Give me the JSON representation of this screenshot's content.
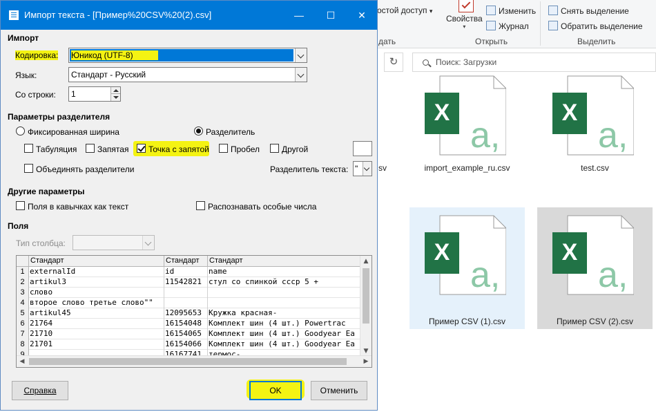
{
  "explorer": {
    "ribbon": {
      "items": {
        "access": "остой доступ",
        "access_arrow": "▾",
        "properties": "Свойства",
        "edit": "Изменить",
        "journal": "Журнал",
        "deselect": "Снять выделение",
        "invert": "Обратить выделение"
      },
      "groups": {
        "partial": "дать",
        "open": "Открыть",
        "select": "Выделить"
      }
    },
    "search_placeholder": "Поиск: Загрузки",
    "refresh_icon": "↻",
    "partial_label": "sv",
    "files": [
      {
        "name": "import_example_ru.csv"
      },
      {
        "name": "test.csv"
      },
      {
        "name": "Пример CSV (1).csv"
      },
      {
        "name": "Пример CSV (2).csv"
      }
    ],
    "colors": {
      "excel_green": "#217346",
      "excel_light": "#8dc8a7",
      "selection": "#e5f1fb"
    },
    "icon_letters": {
      "x": "X",
      "a": "a,"
    }
  },
  "dialog": {
    "title": "Импорт текста - [Пример%20CSV%20(2).csv]",
    "window_buttons": {
      "minimize": "—",
      "maximize": "☐",
      "close": "✕"
    },
    "import": {
      "heading": "Импорт",
      "encoding_label": "Кодировка:",
      "encoding_value": "Юникод (UTF-8)",
      "language_label": "Язык:",
      "language_value": "Стандарт - Русский",
      "from_row_label": "Со строки:",
      "from_row_value": "1"
    },
    "separator": {
      "heading": "Параметры разделителя",
      "fixed_width": "Фиксированная ширина",
      "separated": "Разделитель",
      "tab": "Табуляция",
      "comma": "Запятая",
      "semicolon": "Точка с запятой",
      "space": "Пробел",
      "other": "Другой",
      "merge": "Объединять разделители",
      "text_delimiter_label": "Разделитель текста:",
      "text_delimiter_value": "\""
    },
    "other": {
      "heading": "Другие параметры",
      "quoted_as_text": "Поля в кавычках как текст",
      "special_numbers": "Распознавать особые числа"
    },
    "fields": {
      "heading": "Поля",
      "column_type_label": "Тип столбца:",
      "column_type_value": ""
    },
    "preview": {
      "headers": [
        "Стандарт",
        "Стандарт",
        "Стандарт"
      ],
      "rows": [
        {
          "n": "1",
          "c1": "externalId",
          "c2": "id",
          "c3": "name"
        },
        {
          "n": "2",
          "c1": "artikul3",
          "c2": "11542821",
          "c3": "стул со спинкой ссср 5 +"
        },
        {
          "n": "3",
          "c1": "слово",
          "c2": "",
          "c3": ""
        },
        {
          "n": "4",
          "c1": "второе слово третье слово\"\"",
          "c2": "",
          "c3": ""
        },
        {
          "n": "5",
          "c1": "artikul45",
          "c2": "12095653",
          "c3": "Кружка красная-"
        },
        {
          "n": "6",
          "c1": "21764",
          "c2": "16154048",
          "c3": "Комплект шин (4 шт.) Powertrac"
        },
        {
          "n": "7",
          "c1": "21710",
          "c2": "16154065",
          "c3": "Комплект шин (4 шт.) Goodyear Ea"
        },
        {
          "n": "8",
          "c1": "21701",
          "c2": "16154066",
          "c3": "Комплект шин (4 шт.) Goodyear Ea"
        },
        {
          "n": "9",
          "c1": "",
          "c2": "16167741",
          "c3": "термос-"
        }
      ],
      "scroll_arrows": {
        "up": "▲",
        "down": "▼",
        "left": "◀",
        "right": "▶"
      }
    },
    "buttons": {
      "help": "Справка",
      "ok": "OK",
      "cancel": "Отменить"
    },
    "colors": {
      "title_bar": "#0078d7",
      "highlighter": "#f4f313",
      "selection": "#0078d7"
    }
  }
}
